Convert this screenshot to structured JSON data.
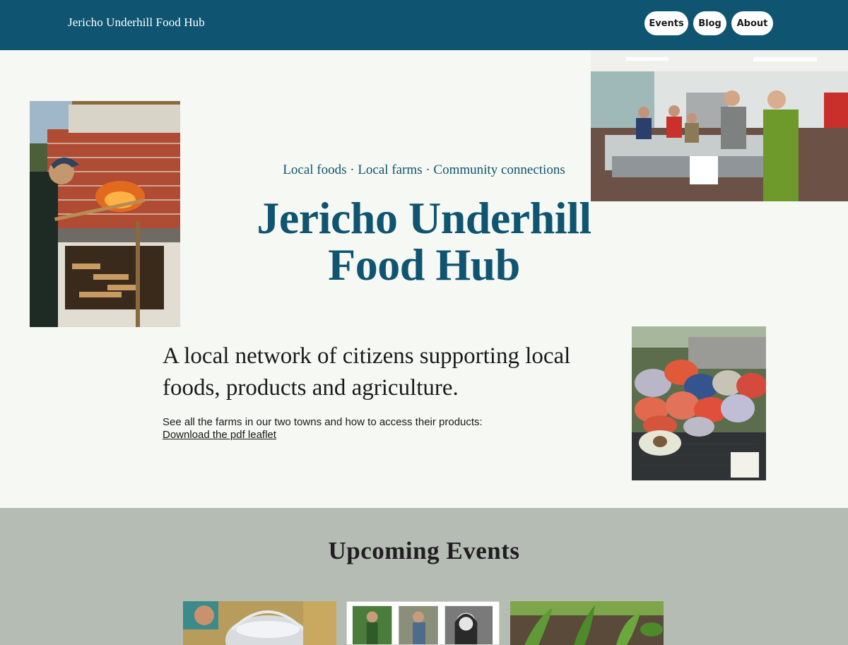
{
  "header": {
    "brand": "Jericho Underhill Food Hub",
    "nav": [
      {
        "label": "Events"
      },
      {
        "label": "Blog"
      },
      {
        "label": "About"
      }
    ]
  },
  "hero": {
    "tagline": "Local foods · Local farms · Community connections",
    "title": "Jericho Underhill Food Hub",
    "lead": "A local network of citizens supporting local foods, products and agriculture.",
    "note": "See all the farms in our two towns and how to access their products:",
    "link": "Download the pdf leaflet"
  },
  "events": {
    "title": "Upcoming Events"
  },
  "colors": {
    "header": "#0f5470",
    "accent_text": "#0f5470",
    "page_bg": "#f6f8f3",
    "events_bg": "#b5bcb4"
  }
}
